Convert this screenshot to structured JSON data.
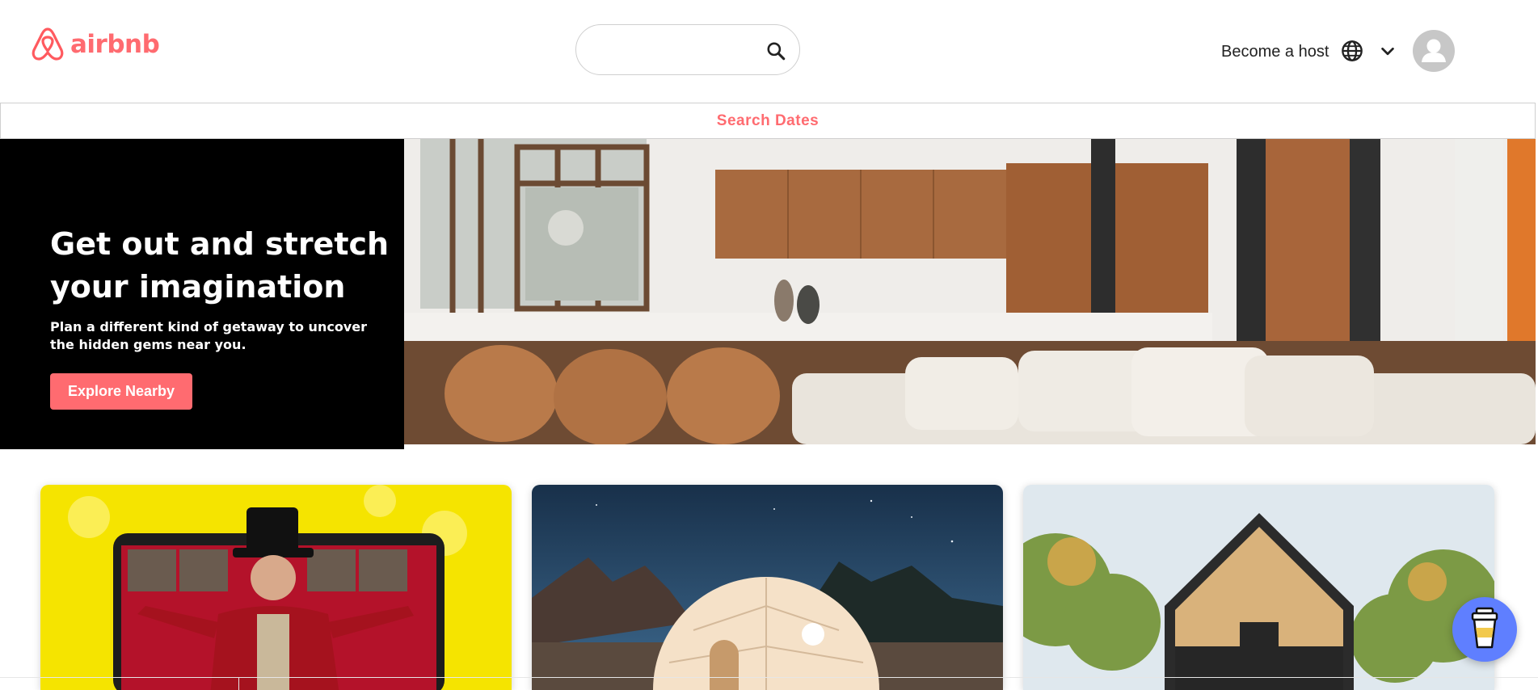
{
  "header": {
    "logo_text": "airbnb",
    "search": {
      "value": "",
      "placeholder": ""
    },
    "become_host_label": "Become a host",
    "icons": [
      "airbnb-logo-icon",
      "search-icon",
      "globe-icon",
      "chevron-down-icon",
      "user-avatar-icon"
    ]
  },
  "dates_bar": {
    "label": "Search Dates"
  },
  "hero": {
    "title": "Get out and stretch your imagination",
    "subtitle": "Plan a different kind of getaway to uncover the hidden gems near you.",
    "cta_label": "Explore Nearby"
  },
  "cards": [
    {
      "image": "online-experience-ringmaster"
    },
    {
      "image": "glamping-dome-night"
    },
    {
      "image": "modern-cabin-woods"
    }
  ],
  "floating_button": {
    "icon": "coffee-cup-icon"
  },
  "colors": {
    "brand": "#ff5a5f",
    "cta": "#ff6b70",
    "fab": "#5f7fff",
    "hero_bg": "#000000"
  }
}
